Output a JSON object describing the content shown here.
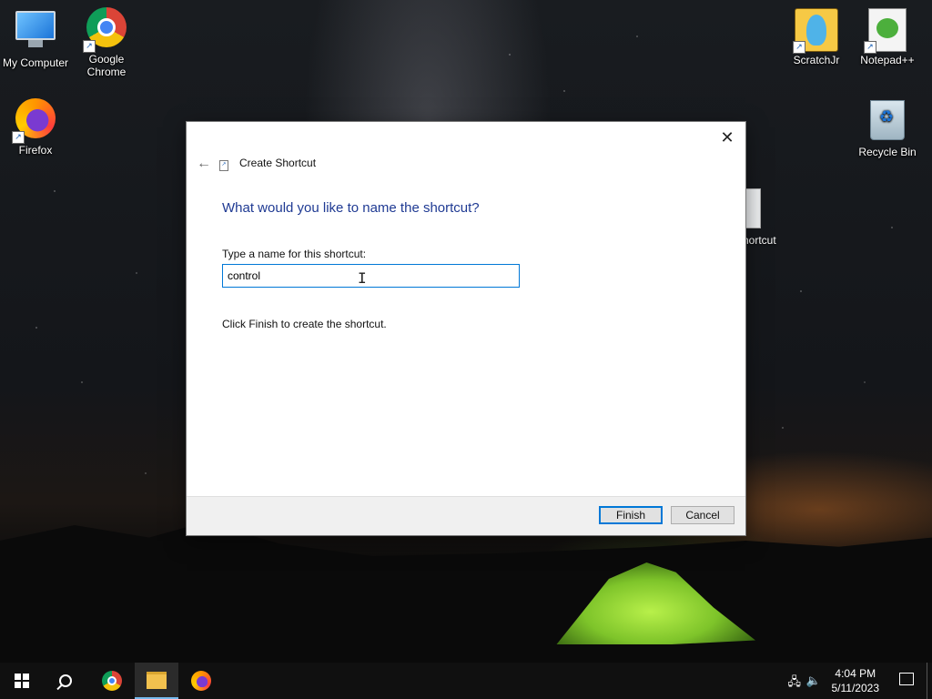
{
  "desktop": {
    "icons_left": [
      {
        "label": "My Computer"
      },
      {
        "label": "Google Chrome"
      },
      {
        "label": "Firefox"
      }
    ],
    "icons_right": [
      {
        "label": "ScratchJr"
      },
      {
        "label": "Notepad++"
      },
      {
        "label": "Recycle Bin"
      }
    ],
    "partial_icon_label": "hortcut"
  },
  "dialog": {
    "title": "Create Shortcut",
    "heading": "What would you like to name the shortcut?",
    "field_label": "Type a name for this shortcut:",
    "name_value": "control",
    "instruction": "Click Finish to create the shortcut.",
    "finish_label": "Finish",
    "cancel_label": "Cancel",
    "close_glyph": "✕",
    "back_glyph": "←"
  },
  "taskbar": {
    "time": "4:04 PM",
    "date": "5/11/2023",
    "items": [
      "start",
      "search",
      "chrome",
      "file-explorer",
      "firefox"
    ]
  }
}
